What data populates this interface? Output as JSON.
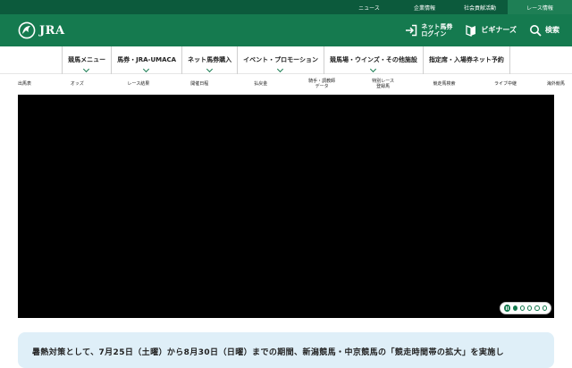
{
  "utility_nav": [
    {
      "label": "ニュース"
    },
    {
      "label": "企業情報"
    },
    {
      "label": "社会貢献活動"
    },
    {
      "label": "レース情報",
      "active": true
    }
  ],
  "header": {
    "logo_text": "JRA",
    "net_login_label": "ネット馬券\nログイン",
    "beginners_label": "ビギナーズ",
    "search_label": "検索"
  },
  "main_nav": [
    {
      "label": "競馬メニュー"
    },
    {
      "label": "馬券・JRA-UMACA"
    },
    {
      "label": "ネット馬券購入"
    },
    {
      "label": "イベント・プロモーション"
    },
    {
      "label": "競馬場・ウインズ・その他施設"
    },
    {
      "label": "指定席・入場券ネット予約"
    }
  ],
  "sub_nav": [
    {
      "label": "出馬表"
    },
    {
      "label": "オッズ"
    },
    {
      "label": "レース結果"
    },
    {
      "label": "開催日程"
    },
    {
      "label": "払戻金"
    },
    {
      "label": "騎手・調教師\nデータ"
    },
    {
      "label": "特別レース\n登録馬"
    },
    {
      "label": "競走馬検索"
    },
    {
      "label": "ライブ中継"
    },
    {
      "label": "海外競馬"
    }
  ],
  "carousel": {
    "slide_count": 5,
    "active_index": 0
  },
  "notice": {
    "text": "暑熱対策として、7月25日（土曜）から8月30日（日曜）までの期間、新潟競馬・中京競馬の「競走時間帯の拡大」を実施し"
  },
  "colors": {
    "brand_green": "#157a4f",
    "dark_green": "#0c5a3c",
    "notice_bg": "#dfeff8"
  }
}
